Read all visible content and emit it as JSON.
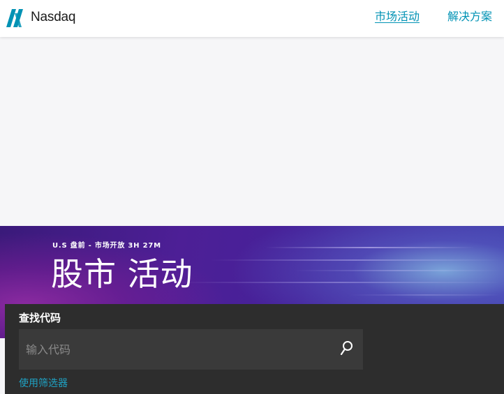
{
  "header": {
    "logo_text": "Nasdaq",
    "nav": [
      {
        "label": "市场活动"
      },
      {
        "label": "解决方案"
      }
    ]
  },
  "hero": {
    "eyebrow": "U.S 盘前 - 市场开放 3H 27M",
    "title": "股市 活动"
  },
  "search": {
    "heading": "查找代码",
    "placeholder": "输入代码",
    "filter_link": "使用筛选器"
  },
  "colors": {
    "accent": "#0092b4",
    "logo": "#0092b4",
    "panel": "#2d2d2d",
    "hero_purple": "#4d1f96"
  },
  "icons": {
    "search": "search-icon",
    "logo": "nasdaq-logo-icon"
  }
}
